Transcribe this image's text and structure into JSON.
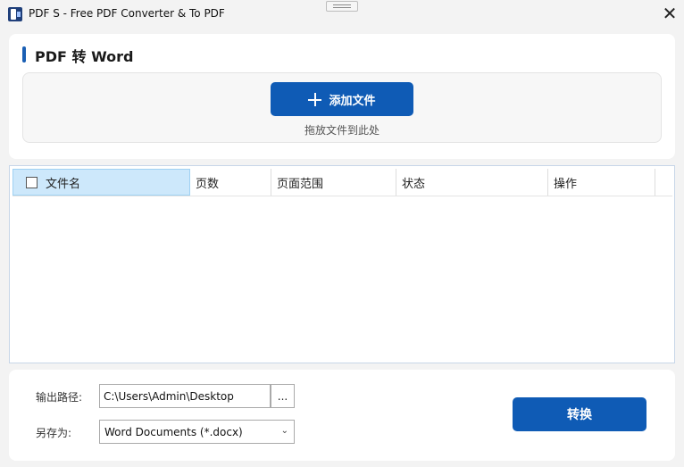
{
  "window": {
    "title": "PDF S - Free PDF Converter & To PDF",
    "close_glyph": "✕"
  },
  "header": {
    "section_title": "PDF 转 Word",
    "add_button_label": "添加文件",
    "drop_hint": "拖放文件到此处"
  },
  "table": {
    "columns": [
      "文件名",
      "页数",
      "页面范围",
      "状态",
      "操作"
    ],
    "rows": []
  },
  "output": {
    "path_label": "输出路径:",
    "path_value": "C:\\Users\\Admin\\Desktop",
    "browse_label": "...",
    "save_as_label": "另存为:",
    "format_value": "Word Documents (*.docx)",
    "convert_label": "转换"
  },
  "colors": {
    "accent": "#0f5bb5",
    "header_selected": "#cde8fb"
  }
}
